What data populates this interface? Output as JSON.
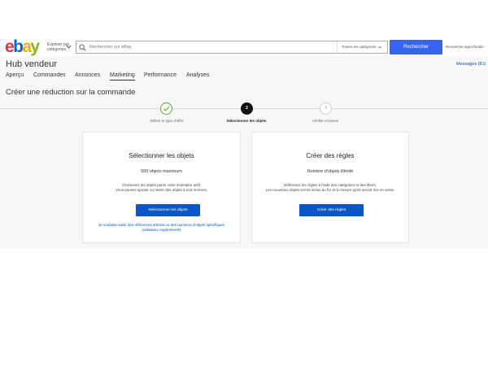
{
  "header": {
    "logo_letters": [
      "e",
      "b",
      "a",
      "y"
    ],
    "logo_colors": [
      "#e53238",
      "#0064d2",
      "#f5af02",
      "#86b817"
    ],
    "explore_label": "Explorer par catégories",
    "explore_icon": "chevron-down-icon",
    "search": {
      "icon": "search-icon",
      "placeholder": "Rechercher sur eBay",
      "category_value": "Toutes les catégories",
      "button_label": "Rechercher",
      "button_color": "#3665f3"
    },
    "advanced_label": "Recherche approfondie"
  },
  "hub": {
    "title": "Hub vendeur",
    "messages_label": "Messages (81)"
  },
  "tabs": [
    {
      "label": "Aperçu",
      "active": false
    },
    {
      "label": "Commandes",
      "active": false
    },
    {
      "label": "Annonces",
      "active": false
    },
    {
      "label": "Marketing",
      "active": true
    },
    {
      "label": "Performance",
      "active": false
    },
    {
      "label": "Analyses",
      "active": false
    }
  ],
  "page": {
    "title": "Créer une réduction sur la commande"
  },
  "stepper": {
    "steps": [
      {
        "number": "",
        "label": "Définir le type d'offre",
        "state": "completed",
        "icon": "check-icon"
      },
      {
        "number": "2",
        "label": "Sélectionner les objets",
        "state": "current"
      },
      {
        "number": "3",
        "label": "Vérifier et lancer",
        "state": "upcoming"
      }
    ],
    "colors": {
      "completed": "#5ba71b",
      "current": "#111111",
      "upcoming": "#cccccc"
    }
  },
  "cards": [
    {
      "title": "Sélectionner les objets",
      "subtitle": "500 objets maximum",
      "description_lines": [
        "Choisissez les objets parmi votre inventaire actif.",
        "Vous pouvez ajouter ou retirer des objets à tout moment."
      ],
      "button_label": "Sélectionner les objets",
      "link_lines": [
        "Je souhaite saisir des références articles ou des numéros d'objets spécifiques",
        "(utilisateur expérimenté)"
      ]
    },
    {
      "title": "Créer des règles",
      "subtitle": "Nombre d'objets illimité",
      "description_lines": [
        "Définissez les règles à l'aide des catégories et des filtres.",
        "Les nouveaux objets seront inclus au fur et à mesure qu'ils seront mis en vente."
      ],
      "button_label": "Créer des règles"
    }
  ],
  "colors": {
    "primary_button": "#0a55c8",
    "link": "#0654ba",
    "background": "#f7f7f7"
  }
}
